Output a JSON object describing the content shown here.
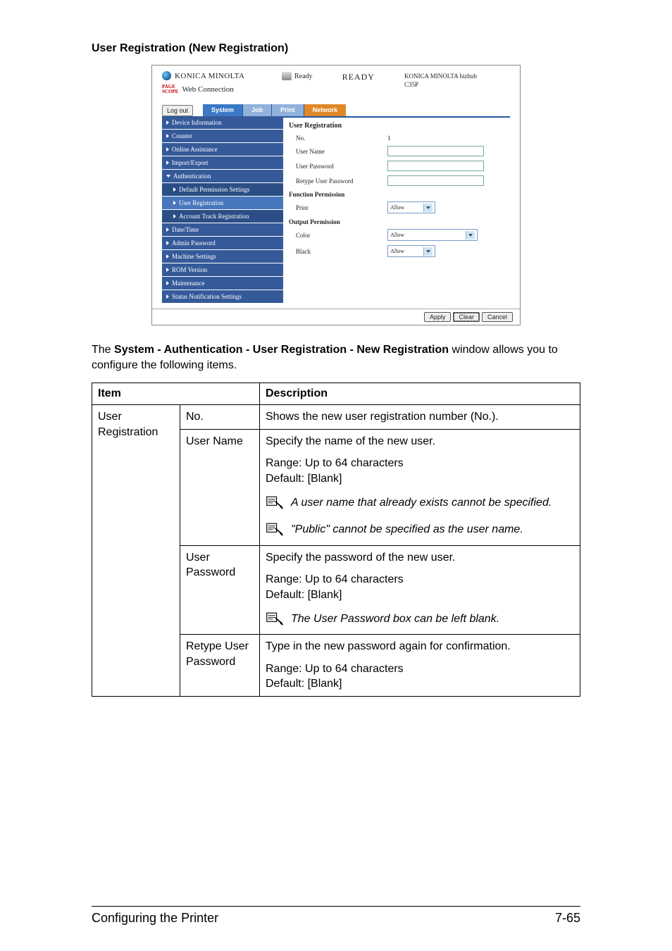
{
  "heading": "User Registration (New Registration)",
  "shot": {
    "brand": "KONICA MINOLTA",
    "product": "Web Connection",
    "badge_top": "PAGE",
    "badge_bot": "SCOPE",
    "ready_small": "Ready",
    "ready_big": "READY",
    "model_line1": "KONICA MINOLTA bizhub",
    "model_line2": "C35P",
    "logout": "Log out",
    "tabs": {
      "system": "System",
      "job": "Job",
      "print": "Print",
      "network": "Network"
    },
    "side": {
      "device": "Device Information",
      "counter": "Counter",
      "online": "Online Assistance",
      "import": "Import/Export",
      "auth": "Authentication",
      "defperm": "Default Permission Settings",
      "userreg": "User Registration",
      "acct": "Account Track Registration",
      "date": "Date/Time",
      "admin": "Admin Password",
      "machine": "Machine Settings",
      "rom": "ROM Version",
      "maint": "Maintenance",
      "status": "Status Notification Settings"
    },
    "content": {
      "title": "User Registration",
      "no_lbl": "No.",
      "no_val": "1",
      "uname": "User Name",
      "upass": "User Password",
      "retype": "Retype User Password",
      "fperm": "Function Permission",
      "print": "Print",
      "operm": "Output Permission",
      "color": "Color",
      "black": "Black",
      "allow": "Allow"
    },
    "buttons": {
      "apply": "Apply",
      "clear": "Clear",
      "cancel": "Cancel"
    }
  },
  "para_pre": "The ",
  "para_bold": "System - Authentication - User Registration - New Registration",
  "para_post": " window allows you to configure the following items.",
  "table": {
    "h_item": "Item",
    "h_desc": "Description",
    "lead": "User Registration",
    "rows": {
      "no": {
        "sub": "No.",
        "desc": "Shows the new user registration number (No.)."
      },
      "uname": {
        "sub": "User Name",
        "line1": "Specify the name of the new user.",
        "range": "Range:   Up to 64 characters",
        "def": "Default:  [Blank]",
        "note1": "A user name that already exists cannot be specified.",
        "note2": "\"Public\" cannot be specified as the user name."
      },
      "upass": {
        "sub": "User Password",
        "line1": "Specify the password of the new user.",
        "range": "Range:   Up to 64 characters",
        "def": "Default:  [Blank]",
        "note": "The User Password box can be left blank."
      },
      "retype": {
        "sub": "Retype User Password",
        "line1": "Type in the new password again for confirmation.",
        "range": "Range:   Up to 64 characters",
        "def": "Default:  [Blank]"
      }
    }
  },
  "footer": {
    "title": "Configuring the Printer",
    "page": "7-65"
  }
}
